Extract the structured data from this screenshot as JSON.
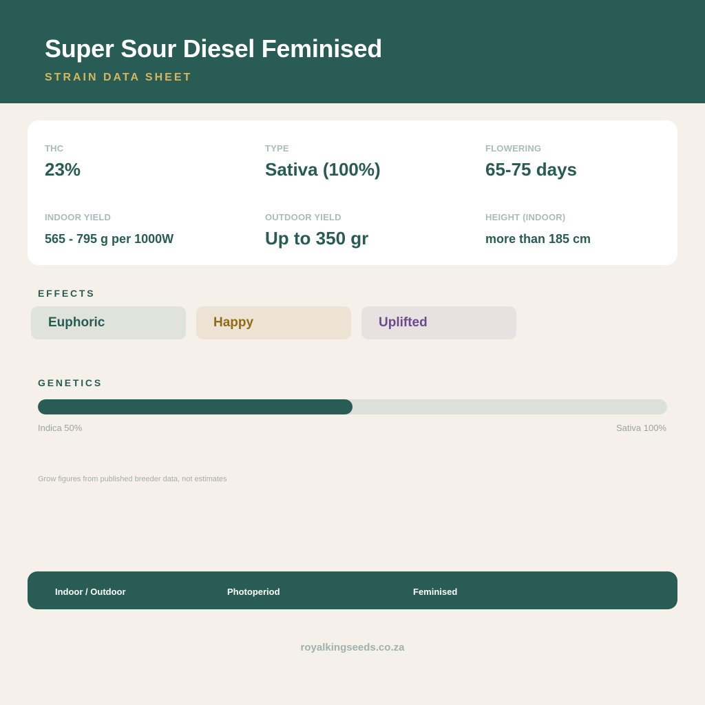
{
  "header": {
    "title": "Super Sour Diesel Feminised",
    "subtitle": "STRAIN DATA SHEET"
  },
  "stats": {
    "thc": {
      "label": "THC",
      "value": "23%"
    },
    "type": {
      "label": "TYPE",
      "value": "Sativa (100%)"
    },
    "flowering": {
      "label": "FLOWERING",
      "value": "65-75 days"
    },
    "indoor_yield": {
      "label": "INDOOR YIELD",
      "value": "565 - 795 g per 1000W"
    },
    "outdoor_yield": {
      "label": "OUTDOOR YIELD",
      "value": "Up to 350 gr"
    },
    "height_indoor": {
      "label": "HEIGHT (INDOOR)",
      "value": "more than 185 cm"
    }
  },
  "effects": {
    "label": "EFFECTS",
    "items": [
      {
        "label": "Euphoric",
        "bg": "#e0e2dc",
        "color": "#285c52"
      },
      {
        "label": "Happy",
        "bg": "#ede3d4",
        "color": "#8f6b17"
      },
      {
        "label": "Uplifted",
        "bg": "#e8e1e2",
        "color": "#6b4a8a"
      }
    ]
  },
  "genetics": {
    "label": "GENETICS",
    "indica_caption": "Indica 50%",
    "sativa_caption": "Sativa 100%",
    "fill_fraction": 0.5
  },
  "footnote": "Grow figures from published breeder data, not estimates",
  "footer": {
    "items": [
      "Indoor / Outdoor",
      "Photoperiod",
      "Feminised"
    ]
  },
  "site_url": "royalkingseeds.co.za",
  "colors": {
    "brand_green": "#285c55",
    "accent_gold": "#d6b75e",
    "page_bg": "#f5f0ea"
  }
}
